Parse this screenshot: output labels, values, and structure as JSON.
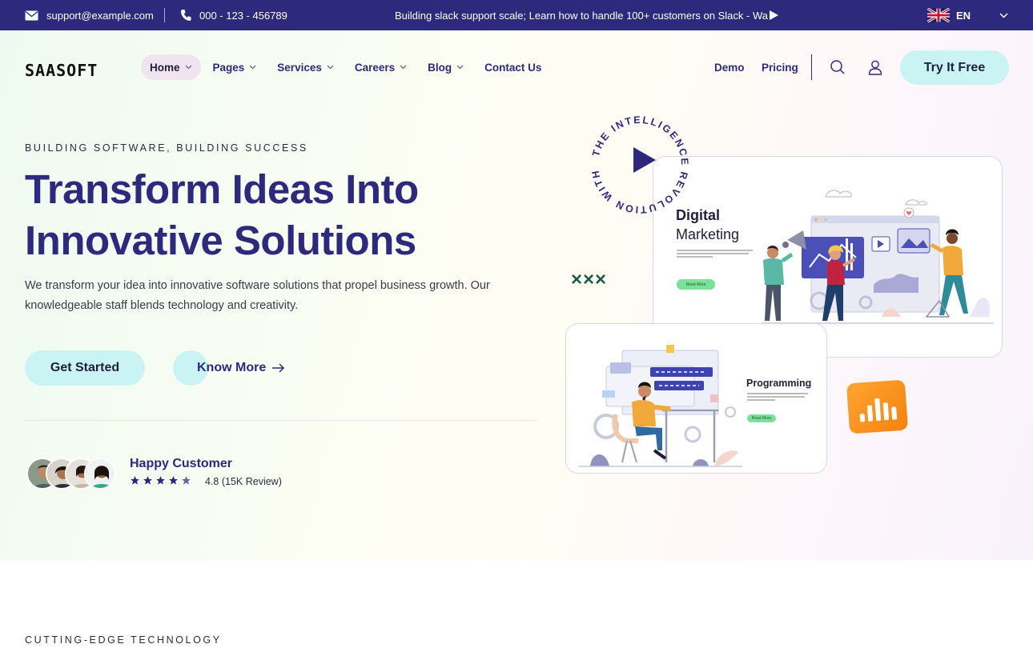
{
  "topbar": {
    "email": "support@example.com",
    "phone": "000 - 123 - 456789",
    "ticker": "Building slack support scale; Learn how to handle 100+ customers on Slack - Wa",
    "language": "EN"
  },
  "header": {
    "logo": "SAASOFT",
    "nav": [
      {
        "label": "Home",
        "has_dropdown": true,
        "active": true
      },
      {
        "label": "Pages",
        "has_dropdown": true
      },
      {
        "label": "Services",
        "has_dropdown": true
      },
      {
        "label": "Careers",
        "has_dropdown": true
      },
      {
        "label": "Blog",
        "has_dropdown": true
      },
      {
        "label": "Contact Us",
        "has_dropdown": false
      }
    ],
    "right_links": [
      "Demo",
      "Pricing"
    ],
    "cta": "Try It Free"
  },
  "hero": {
    "eyebrow": "BUILDING SOFTWARE, BUILDING SUCCESS",
    "headline_line1": "Transform Ideas Into",
    "headline_line2": "Innovative Solutions",
    "lead": "We transform your idea into innovative software solutions that propel business growth. Our knowledgeable staff blends technology and creativity.",
    "primary_button": "Get Started",
    "secondary_button": "Know More",
    "social_proof": {
      "title": "Happy Customer",
      "rating_text": "4.8 (15K Review)",
      "stars": 4.8
    }
  },
  "illustrations": {
    "circle_text": "THE INTELLIGENCE REVOLUTION WITH AI",
    "card1_title_line1": "Digital",
    "card1_title_line2": "Marketing",
    "card1_button": "Read More",
    "card2_title": "Programming",
    "card2_button": "Read More",
    "decor_text": "×××"
  },
  "next_section": {
    "eyebrow": "CUTTING-EDGE TECHNOLOGY"
  },
  "colors": {
    "brand": "#2d2a7e",
    "accent": "#c9f4f3",
    "orange": "#f7901e",
    "green": "#1c5c4b"
  }
}
